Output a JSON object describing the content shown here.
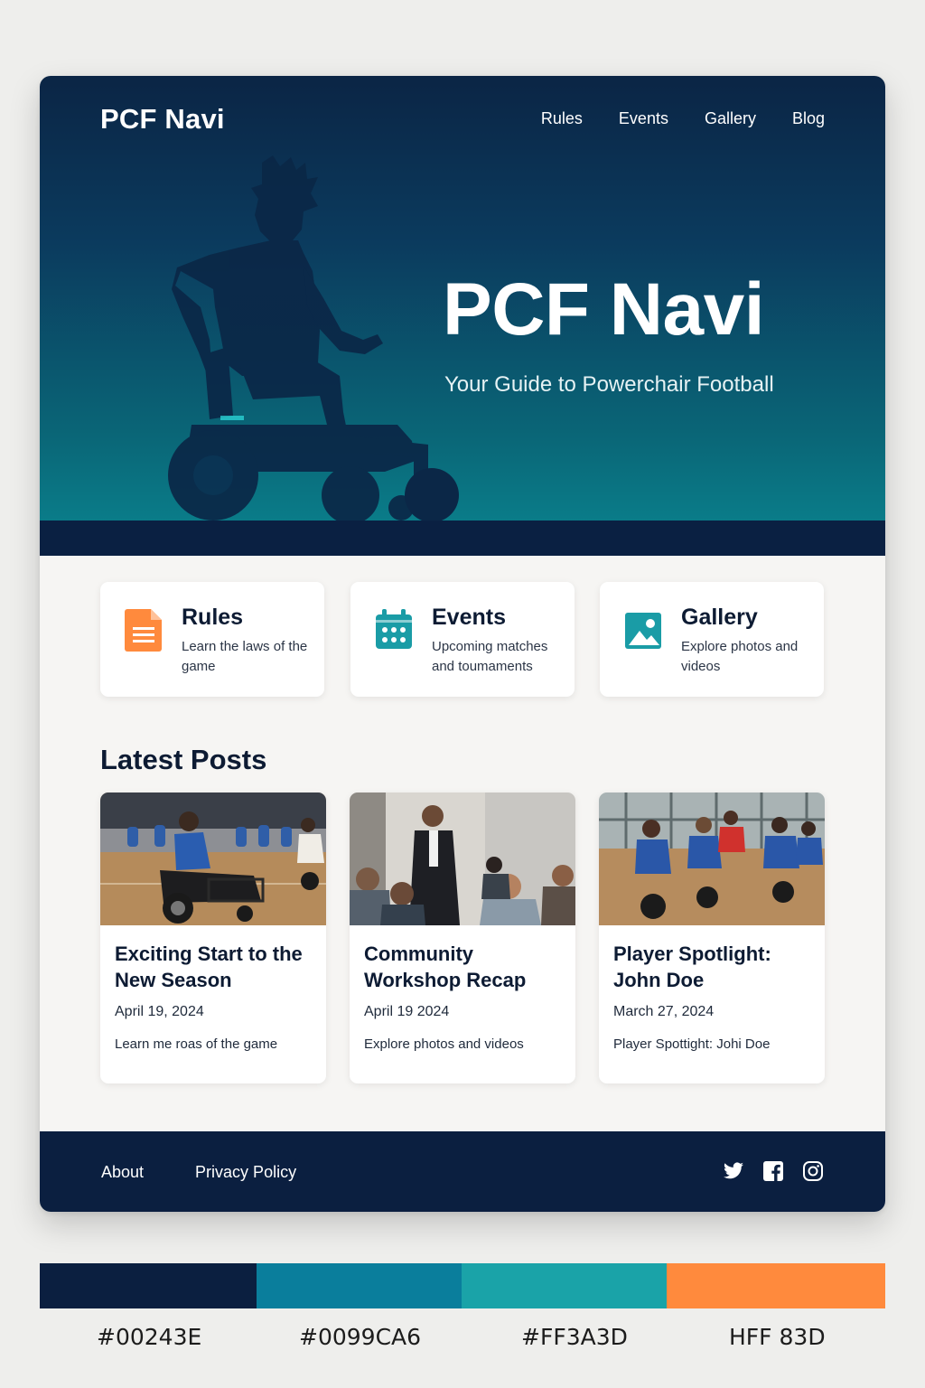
{
  "site": {
    "brand": "PCF Navi",
    "nav": [
      "Rules",
      "Events",
      "Gallery",
      "Blog"
    ]
  },
  "hero": {
    "title": "PCF Navi",
    "subtitle": "Your Guide to Powerchair Football"
  },
  "features": [
    {
      "title": "Rules",
      "description": "Learn the laws of the game",
      "icon": "document-icon",
      "color": "#FF8A3D"
    },
    {
      "title": "Events",
      "description": "Upcoming matches and toumaments",
      "icon": "calendar-icon",
      "color": "#1A9CA6"
    },
    {
      "title": "Gallery",
      "description": "Explore photos and videos",
      "icon": "image-icon",
      "color": "#1A9CA6"
    }
  ],
  "latest_posts": {
    "heading": "Latest Posts",
    "posts": [
      {
        "title": "Exciting Start to the New Season",
        "date": "April 19, 2024",
        "excerpt": "Learn me roas of the game",
        "image": "powerchair-match-photo"
      },
      {
        "title": "Community Workshop Recap",
        "date": "April 19 2024",
        "excerpt": "Explore photos and videos",
        "image": "workshop-presentation-photo"
      },
      {
        "title": "Player Spotlight: John Doe",
        "date": "March 27, 2024",
        "excerpt": "Player Spottight: Johi Doe",
        "image": "team-gym-photo"
      }
    ]
  },
  "footer": {
    "links": [
      "About",
      "Privacy Policy"
    ],
    "social_icons": [
      "twitter-icon",
      "facebook-icon",
      "instagram-icon"
    ]
  },
  "palette": [
    {
      "color": "#00243E",
      "label": "#00243E"
    },
    {
      "color": "#0099CA6",
      "label": "#0099CA6"
    },
    {
      "color": "#1AA3A8",
      "label": "#FF3A3D"
    },
    {
      "color": "#FF8A3D",
      "label": "HFF 83D"
    }
  ],
  "colors": {
    "navy": "#0B1F40",
    "teal": "#1A9CA6",
    "orange": "#FF8A3D"
  }
}
